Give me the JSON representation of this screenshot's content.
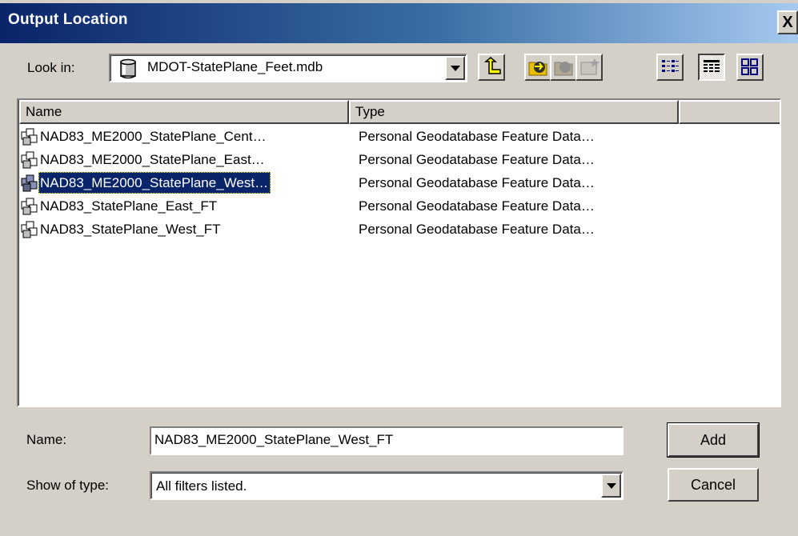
{
  "dialog": {
    "title": "Output Location",
    "close_label": "X"
  },
  "lookin": {
    "label": "Look in:",
    "value": "MDOT-StatePlane_Feet.mdb",
    "value_icon": "database-icon"
  },
  "toolbar": {
    "buttons": [
      {
        "icon": "up-one-level-icon"
      },
      {
        "icon": "connect-folder-icon"
      },
      {
        "icon": "disconnect-folder-icon"
      },
      {
        "icon": "new-item-icon"
      },
      {
        "icon": "list-view-icon"
      },
      {
        "icon": "details-view-icon"
      },
      {
        "icon": "thumbnails-view-icon"
      }
    ]
  },
  "list": {
    "columns": [
      "Name",
      "Type"
    ],
    "rows": [
      {
        "name": "NAD83_ME2000_StatePlane_Cent…",
        "type": "Personal Geodatabase Feature Data…",
        "selected": false
      },
      {
        "name": "NAD83_ME2000_StatePlane_East…",
        "type": "Personal Geodatabase Feature Data…",
        "selected": false
      },
      {
        "name": "NAD83_ME2000_StatePlane_West…",
        "type": "Personal Geodatabase Feature Data…",
        "selected": true
      },
      {
        "name": "NAD83_StatePlane_East_FT",
        "type": "Personal Geodatabase Feature Data…",
        "selected": false
      },
      {
        "name": "NAD83_StatePlane_West_FT",
        "type": "Personal Geodatabase Feature Data…",
        "selected": false
      }
    ],
    "row_icon": "feature-dataset-icon"
  },
  "form": {
    "name_label": "Name:",
    "name_value": "NAD83_ME2000_StatePlane_West_FT",
    "type_label": "Show of type:",
    "type_value": "All filters listed.",
    "add_label": "Add",
    "cancel_label": "Cancel"
  },
  "colors": {
    "title_start": "#0a246a",
    "title_end": "#a6caf0",
    "face": "#d4d0c8",
    "selection": "#0a246a"
  }
}
